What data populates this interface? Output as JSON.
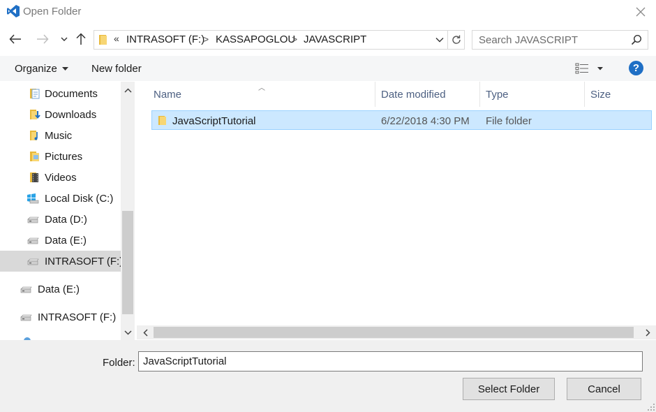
{
  "window": {
    "title": "Open Folder",
    "icon": "vscode-icon",
    "accent": "#1f6fc5"
  },
  "nav": {
    "back_icon": "arrow-left-icon",
    "forward_icon": "arrow-right-icon",
    "recent_icon": "chevron-down-icon",
    "up_icon": "arrow-up-icon",
    "overflow": "«",
    "breadcrumbs": [
      "INTRASOFT (F:)",
      "KASSAPOGLOU",
      "JAVASCRIPT"
    ],
    "separator": ">",
    "search_placeholder": "Search JAVASCRIPT"
  },
  "toolbar": {
    "organize_label": "Organize",
    "new_folder_label": "New folder",
    "help_label": "?"
  },
  "sidebar": {
    "items": [
      {
        "label": "Documents",
        "icon": "documents-icon"
      },
      {
        "label": "Downloads",
        "icon": "downloads-icon"
      },
      {
        "label": "Music",
        "icon": "music-icon"
      },
      {
        "label": "Pictures",
        "icon": "pictures-icon"
      },
      {
        "label": "Videos",
        "icon": "videos-icon"
      },
      {
        "label": "Local Disk (C:)",
        "icon": "windows-drive-icon"
      },
      {
        "label": "Data (D:)",
        "icon": "drive-icon"
      },
      {
        "label": "Data (E:)",
        "icon": "drive-icon"
      },
      {
        "label": "INTRASOFT (F:)",
        "icon": "drive-icon",
        "selected": true
      },
      {
        "label": "Data (E:)",
        "icon": "drive-icon"
      },
      {
        "label": "INTRASOFT (F:)",
        "icon": "drive-icon"
      }
    ]
  },
  "columns": [
    "Name",
    "Date modified",
    "Type",
    "Size"
  ],
  "files": [
    {
      "name": "JavaScriptTutorial",
      "date_modified": "6/22/2018 4:30 PM",
      "type": "File folder",
      "size": ""
    }
  ],
  "footer": {
    "folder_label": "Folder:",
    "folder_value": "JavaScriptTutorial",
    "select_button": "Select Folder",
    "cancel_button": "Cancel"
  }
}
